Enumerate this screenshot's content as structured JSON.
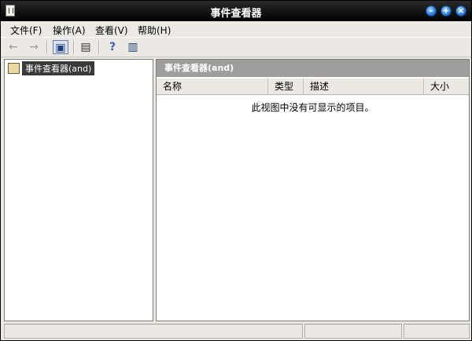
{
  "window": {
    "title": "事件查看器"
  },
  "menu": [
    {
      "label": "文件(F)"
    },
    {
      "label": "操作(A)"
    },
    {
      "label": "查看(V)"
    },
    {
      "label": "帮助(H)"
    }
  ],
  "toolbar": {
    "back_icon": "←",
    "forward_icon": "→",
    "tree_icon": "▣",
    "export_icon": "▤",
    "help_icon": "?",
    "panel_icon": "▥"
  },
  "tree": {
    "root_label": "事件查看器(and)"
  },
  "main": {
    "header": "事件查看器(and)",
    "columns": [
      "名称",
      "类型",
      "描述",
      "大小"
    ],
    "empty_message": "此视图中没有可显示的项目。"
  },
  "colors": {
    "titlebar": "#000000",
    "accent": "#1e6fd0",
    "pane_header": "#9e9e9e"
  }
}
